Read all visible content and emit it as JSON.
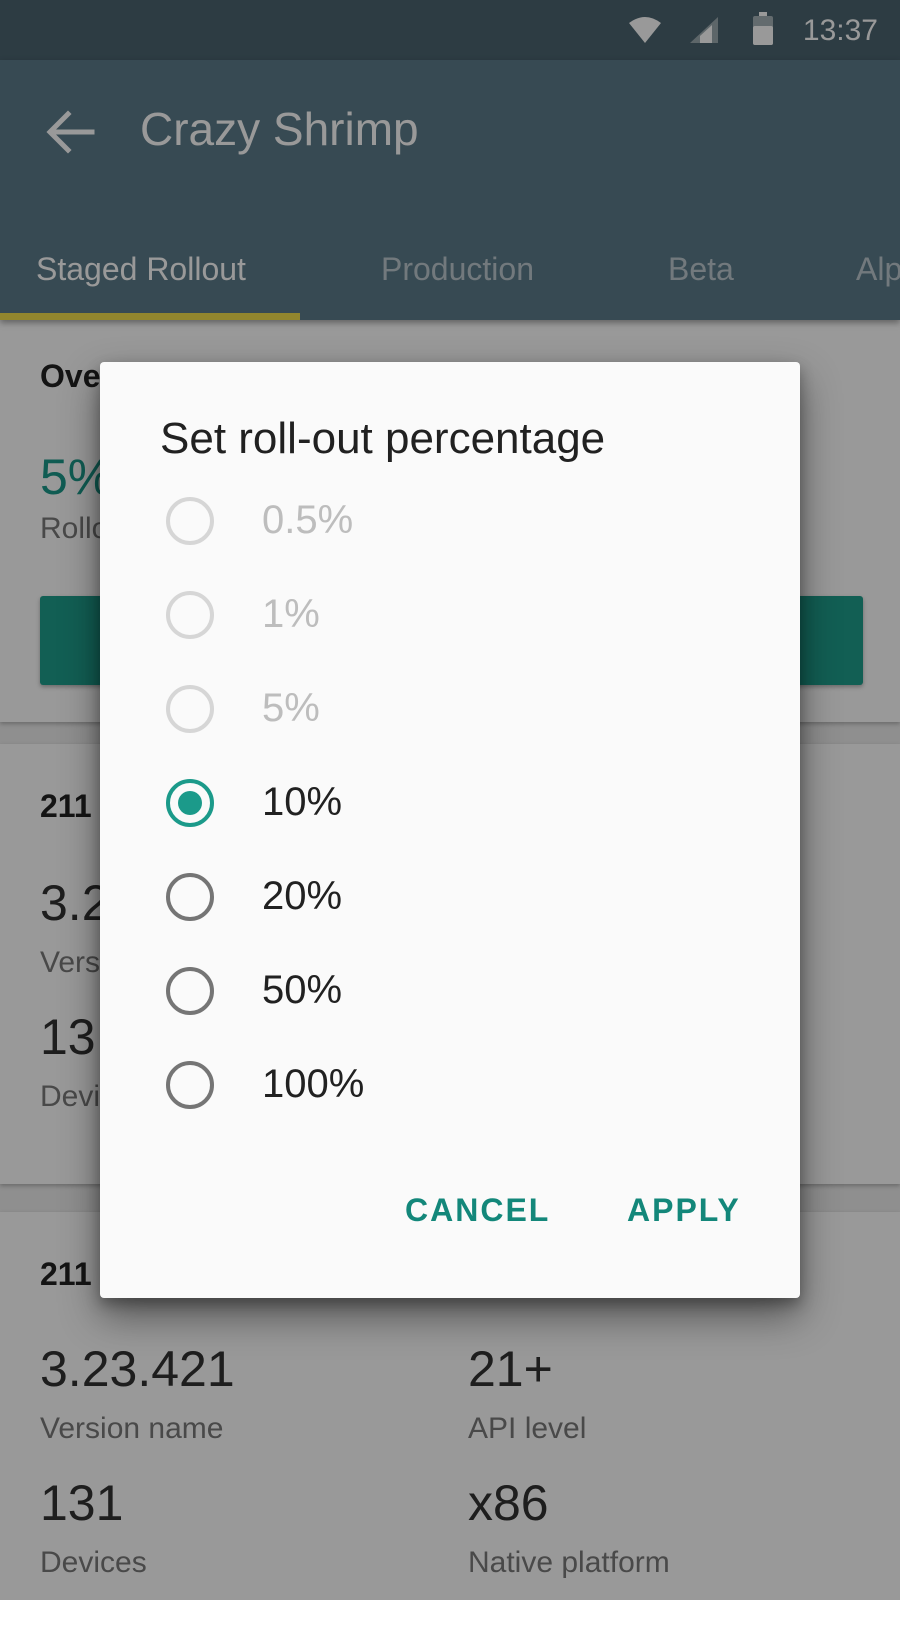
{
  "status_bar": {
    "time": "13:37"
  },
  "app_bar": {
    "title": "Crazy Shrimp"
  },
  "tabs": [
    {
      "label": "Staged Rollout",
      "active": true
    },
    {
      "label": "Production",
      "active": false
    },
    {
      "label": "Beta",
      "active": false
    },
    {
      "label": "Alp",
      "active": false
    }
  ],
  "background": {
    "overview": {
      "heading": "Ove",
      "percent": "5%",
      "percent_label": "Rollo"
    },
    "card2": {
      "heading": "211",
      "version_name": "3.2",
      "version_label": "Versi",
      "devices": "13",
      "devices_label": "Devi"
    },
    "card3": {
      "heading": "211",
      "version_name": "3.23.421",
      "version_label": "Version name",
      "api_level": "21+",
      "api_label": "API level",
      "devices": "131",
      "devices_label": "Devices",
      "native_platform": "x86",
      "native_platform_label": "Native platform"
    }
  },
  "dialog": {
    "title": "Set roll-out percentage",
    "options": [
      {
        "label": "0.5%",
        "enabled": false,
        "selected": false
      },
      {
        "label": "1%",
        "enabled": false,
        "selected": false
      },
      {
        "label": "5%",
        "enabled": false,
        "selected": false
      },
      {
        "label": "10%",
        "enabled": true,
        "selected": true
      },
      {
        "label": "20%",
        "enabled": true,
        "selected": false
      },
      {
        "label": "50%",
        "enabled": true,
        "selected": false
      },
      {
        "label": "100%",
        "enabled": true,
        "selected": false
      }
    ],
    "cancel_label": "CANCEL",
    "apply_label": "APPLY"
  },
  "colors": {
    "primary": "#5d7c8a",
    "status_bar": "#4b6470",
    "accent": "#1b9a8a",
    "tab_indicator": "#f4e04d"
  }
}
